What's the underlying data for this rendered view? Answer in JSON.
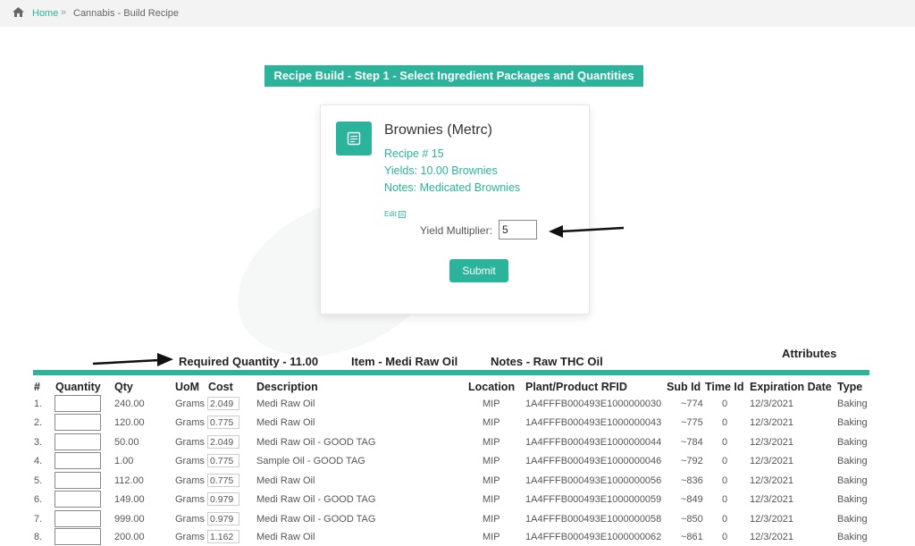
{
  "breadcrumb": {
    "home": "Home",
    "separator": "»",
    "current": "Cannabis - Build Recipe"
  },
  "step_title": "Recipe Build - Step 1 - Select Ingredient Packages and Quantities",
  "recipe": {
    "name": "Brownies (Metrc)",
    "recipe_number": "Recipe # 15",
    "yields": "Yields: 10.00 Brownies",
    "notes": "Notes: Medicated Brownies",
    "edit_label": "Edit",
    "yield_multiplier_label": "Yield Multiplier:",
    "yield_multiplier_value": "5",
    "submit_label": "Submit"
  },
  "summary": {
    "required_quantity": "Required Quantity - 11.00",
    "item": "Item - Medi Raw Oil",
    "notes": "Notes - Raw THC Oil",
    "attributes": "Attributes"
  },
  "table": {
    "columns": [
      "#",
      "Quantity",
      "Qty",
      "UoM",
      "Cost",
      "Description",
      "Location",
      "Plant/Product RFID",
      "Sub Id",
      "Time Id",
      "Expiration Date",
      "Type"
    ],
    "rows": [
      {
        "num": "1.",
        "qty": "240.00",
        "uom": "Grams",
        "cost": "2.049",
        "desc": "Medi Raw Oil",
        "loc": "MIP",
        "rfid": "1A4FFFB000493E1000000030",
        "subid": "~774",
        "timeid": "0",
        "exp": "12/3/2021",
        "type": "Baking"
      },
      {
        "num": "2.",
        "qty": "120.00",
        "uom": "Grams",
        "cost": "0.775",
        "desc": "Medi Raw Oil",
        "loc": "MIP",
        "rfid": "1A4FFFB000493E1000000043",
        "subid": "~775",
        "timeid": "0",
        "exp": "12/3/2021",
        "type": "Baking"
      },
      {
        "num": "3.",
        "qty": "50.00",
        "uom": "Grams",
        "cost": "2.049",
        "desc": "Medi Raw Oil - GOOD TAG",
        "loc": "MIP",
        "rfid": "1A4FFFB000493E1000000044",
        "subid": "~784",
        "timeid": "0",
        "exp": "12/3/2021",
        "type": "Baking"
      },
      {
        "num": "4.",
        "qty": "1.00",
        "uom": "Grams",
        "cost": "0.775",
        "desc": "Sample Oil - GOOD TAG",
        "loc": "MIP",
        "rfid": "1A4FFFB000493E1000000046",
        "subid": "~792",
        "timeid": "0",
        "exp": "12/3/2021",
        "type": "Baking"
      },
      {
        "num": "5.",
        "qty": "112.00",
        "uom": "Grams",
        "cost": "0.775",
        "desc": "Medi Raw Oil",
        "loc": "MIP",
        "rfid": "1A4FFFB000493E1000000056",
        "subid": "~836",
        "timeid": "0",
        "exp": "12/3/2021",
        "type": "Baking"
      },
      {
        "num": "6.",
        "qty": "149.00",
        "uom": "Grams",
        "cost": "0.979",
        "desc": "Medi Raw Oil - GOOD TAG",
        "loc": "MIP",
        "rfid": "1A4FFFB000493E1000000059",
        "subid": "~849",
        "timeid": "0",
        "exp": "12/3/2021",
        "type": "Baking"
      },
      {
        "num": "7.",
        "qty": "999.00",
        "uom": "Grams",
        "cost": "0.979",
        "desc": "Medi Raw Oil - GOOD TAG",
        "loc": "MIP",
        "rfid": "1A4FFFB000493E1000000058",
        "subid": "~850",
        "timeid": "0",
        "exp": "12/3/2021",
        "type": "Baking"
      },
      {
        "num": "8.",
        "qty": "200.00",
        "uom": "Grams",
        "cost": "1.162",
        "desc": "Medi Raw Oil",
        "loc": "MIP",
        "rfid": "1A4FFFB000493E1000000062",
        "subid": "~861",
        "timeid": "0",
        "exp": "12/3/2021",
        "type": "Baking"
      }
    ]
  },
  "colors": {
    "accent": "#2bb39b",
    "breadcrumb_bg": "#f3f3f3"
  },
  "icons": {
    "home": "home-icon",
    "recipe": "document-icon",
    "edit": "edit-icon"
  }
}
